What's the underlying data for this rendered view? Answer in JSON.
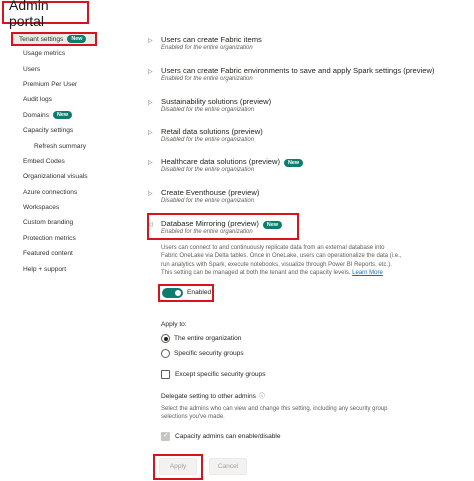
{
  "header": {
    "title": "Admin portal"
  },
  "sidebar": {
    "items": [
      {
        "label": "Tenant settings",
        "badge": "New"
      },
      {
        "label": "Usage metrics"
      },
      {
        "label": "Users"
      },
      {
        "label": "Premium Per User"
      },
      {
        "label": "Audit logs"
      },
      {
        "label": "Domains",
        "badge": "New"
      },
      {
        "label": "Capacity settings"
      },
      {
        "label": "Refresh summary"
      },
      {
        "label": "Embed Codes"
      },
      {
        "label": "Organizational visuals"
      },
      {
        "label": "Azure connections"
      },
      {
        "label": "Workspaces"
      },
      {
        "label": "Custom branding"
      },
      {
        "label": "Protection metrics"
      },
      {
        "label": "Featured content"
      },
      {
        "label": "Help + support"
      }
    ]
  },
  "settings": [
    {
      "name": "Users can create Fabric items",
      "desc": "Enabled for the entire organization"
    },
    {
      "name": "Users can create Fabric environments to save and apply Spark settings (preview)",
      "desc": "Enabled for the entire organization"
    },
    {
      "name": "Sustainability solutions (preview)",
      "desc": "Disabled for the entire organization"
    },
    {
      "name": "Retail data solutions (preview)",
      "desc": "Disabled for the entire organization"
    },
    {
      "name": "Healthcare data solutions (preview)",
      "desc": "Disabled for the entire organization",
      "badge": "New"
    },
    {
      "name": "Create Eventhouse (preview)",
      "desc": "Disabled for the entire organization"
    },
    {
      "name": "Database Mirroring (preview)",
      "desc": "Enabled for the entire organization",
      "badge": "New"
    }
  ],
  "mirroring": {
    "description_lines": [
      "Users can connect to and continuously replicate data from an external database into",
      "Fabric OneLake via Delta tables. Once in OneLake, users can operationalize the data (i.e.,",
      "run analytics with Spark, execute notebooks, visualize through Power BI Reports, etc.).",
      "This setting can be managed at both the tenant and the capacity levels."
    ],
    "learn_more": "Learn More",
    "toggle_label": "Enabled",
    "apply_to_label": "Apply to:",
    "option_entire_org": "The entire organization",
    "option_groups": "Specific security groups",
    "except_label": "Except specific security groups",
    "delegate_label": "Delegate setting to other admins",
    "delegate_desc_lines": [
      "Select the admins who can view and change this setting, including any security group",
      "selections you've made."
    ],
    "capacity_admins_label": "Capacity admins can enable/disable",
    "apply_button": "Apply",
    "cancel_button": "Cancel"
  },
  "colors": {
    "accent": "#107c6e",
    "highlight": "#d6141b",
    "link": "#0f6cbd"
  }
}
